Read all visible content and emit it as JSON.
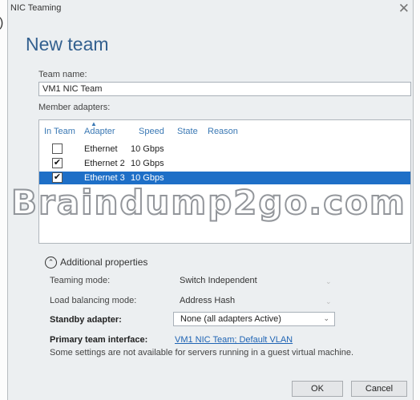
{
  "edge_fragment": ")",
  "window": {
    "title": "NIC Teaming"
  },
  "dialog": {
    "heading": "New team"
  },
  "team_name": {
    "label": "Team name:",
    "value": "VM1 NIC Team"
  },
  "member_adapters": {
    "label": "Member adapters:",
    "columns": [
      "In Team",
      "Adapter",
      "Speed",
      "State",
      "Reason"
    ],
    "rows": [
      {
        "adapter": "Ethernet",
        "speed": "10 Gbps",
        "in_team": false,
        "selected": false
      },
      {
        "adapter": "Ethernet 2",
        "speed": "10 Gbps",
        "in_team": true,
        "selected": false
      },
      {
        "adapter": "Ethernet 3",
        "speed": "10 Gbps",
        "in_team": true,
        "selected": true
      }
    ]
  },
  "watermark": "Braindump2go.com",
  "additional": {
    "toggle_label": "Additional properties",
    "teaming_mode": {
      "label": "Teaming mode:",
      "value": "Switch Independent"
    },
    "load_balancing": {
      "label": "Load balancing mode:",
      "value": "Address Hash"
    },
    "standby_adapter": {
      "label": "Standby adapter:",
      "value": "None (all adapters Active)"
    },
    "primary_interface": {
      "label": "Primary team interface:",
      "link": "VM1 NIC Team; Default VLAN"
    },
    "note": "Some settings are not available for servers running in a guest virtual machine."
  },
  "buttons": {
    "ok": "OK",
    "cancel": "Cancel"
  },
  "colors": {
    "accent": "#33608f",
    "selection": "#1e6fc7",
    "link": "#1f64b4"
  }
}
